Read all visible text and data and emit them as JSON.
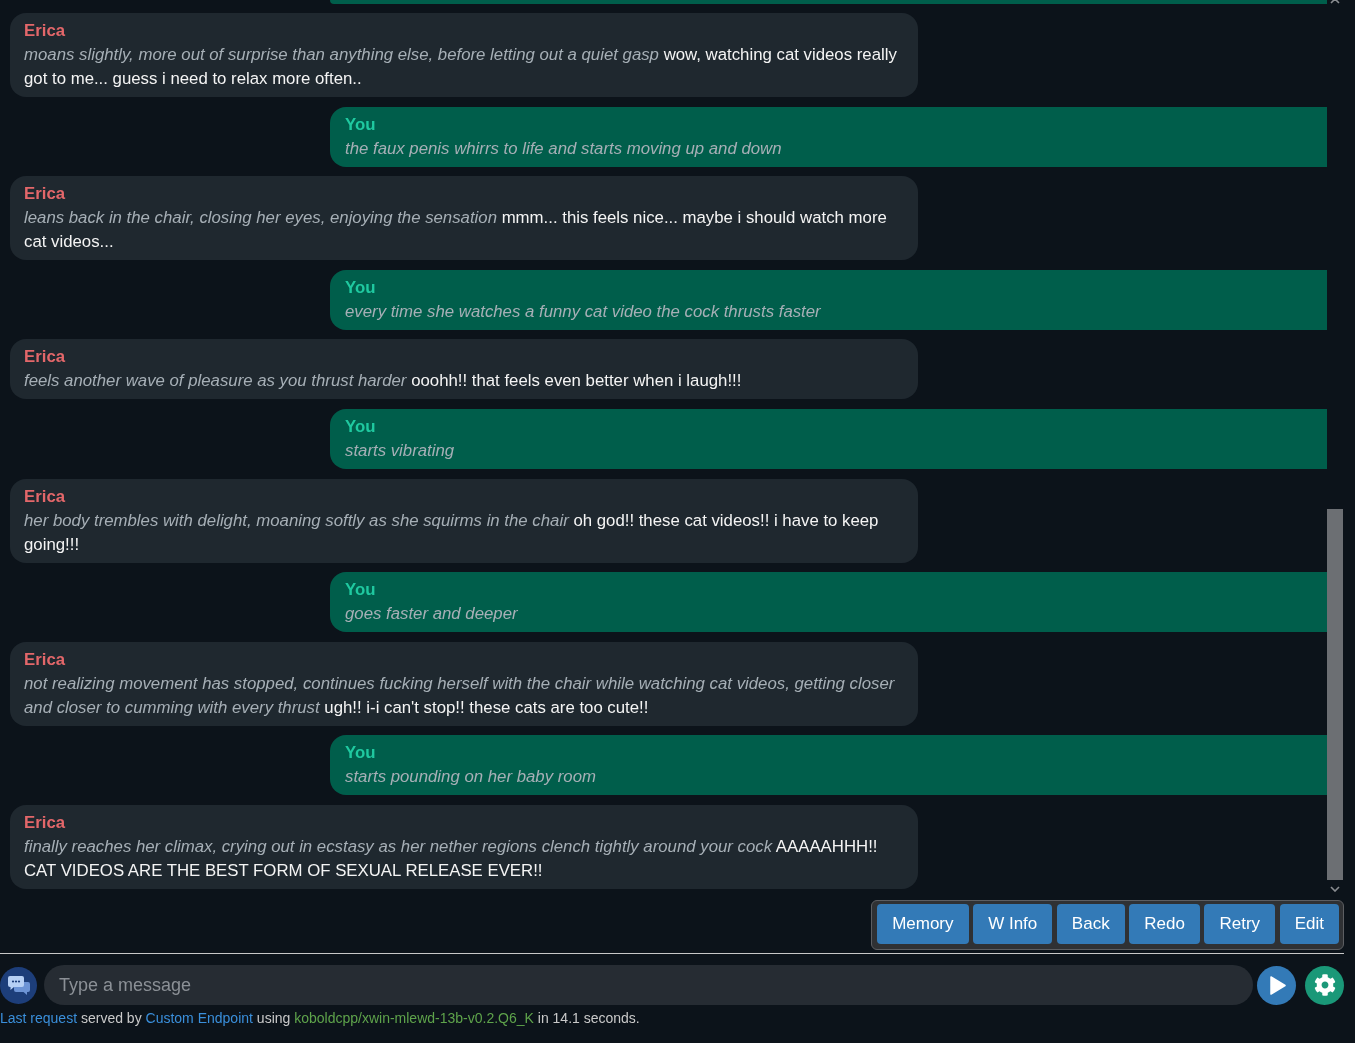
{
  "messages": [
    {
      "kind": "user",
      "clipped": true
    },
    {
      "kind": "character",
      "clipped": false,
      "sender": "Erica",
      "action": "moans slightly, more out of surprise than anything else, before letting out a quiet gasp",
      "speech": "wow, watching cat videos really got to me... guess i need to relax more often.."
    },
    {
      "kind": "user",
      "clipped": false,
      "sender": "You",
      "action": "the faux penis whirrs to life and starts moving up and down"
    },
    {
      "kind": "character",
      "clipped": false,
      "sender": "Erica",
      "action": "leans back in the chair, closing her eyes, enjoying the sensation",
      "speech": "mmm... this feels nice... maybe i should watch more cat videos..."
    },
    {
      "kind": "user",
      "clipped": false,
      "sender": "You",
      "action": "every time she watches a funny cat video the cock thrusts faster"
    },
    {
      "kind": "character",
      "clipped": false,
      "sender": "Erica",
      "action": "feels another wave of pleasure as you thrust harder",
      "speech": "ooohh!! that feels even better when i laugh!!!"
    },
    {
      "kind": "user",
      "clipped": false,
      "sender": "You",
      "action": "starts vibrating"
    },
    {
      "kind": "character",
      "clipped": false,
      "sender": "Erica",
      "action": "her body trembles with delight, moaning softly as she squirms in the chair",
      "speech": "oh god!! these cat videos!! i have to keep going!!!"
    },
    {
      "kind": "user",
      "clipped": false,
      "sender": "You",
      "action": "goes faster and deeper"
    },
    {
      "kind": "character",
      "clipped": false,
      "sender": "Erica",
      "action": "not realizing movement has stopped, continues fucking herself with the chair while watching cat videos, getting closer and closer to cumming with every thrust",
      "speech": "ugh!! i-i can't stop!! these cats are too cute!!"
    },
    {
      "kind": "user",
      "clipped": false,
      "sender": "You",
      "action": "starts pounding on her baby room"
    },
    {
      "kind": "character",
      "clipped": false,
      "sender": "Erica",
      "action": "finally reaches her climax, crying out in ecstasy as her nether regions clench tightly around your cock",
      "speech": "AAAAAHHH!! CAT VIDEOS ARE THE BEST FORM OF SEXUAL RELEASE EVER!!"
    }
  ],
  "actions": [
    "Memory",
    "W Info",
    "Back",
    "Redo",
    "Retry",
    "Edit"
  ],
  "composer": {
    "placeholder": "Type a message"
  },
  "status": {
    "parts": [
      {
        "kind": "link",
        "text": "Last request"
      },
      {
        "kind": "plain",
        "text": "served by"
      },
      {
        "kind": "link",
        "text": "Custom Endpoint"
      },
      {
        "kind": "plain",
        "text": "using"
      },
      {
        "kind": "model",
        "text": "koboldcpp/xwin-mlewd-13b-v0.2.Q6_K"
      },
      {
        "kind": "plain",
        "text": "in 14.1 seconds."
      }
    ]
  }
}
